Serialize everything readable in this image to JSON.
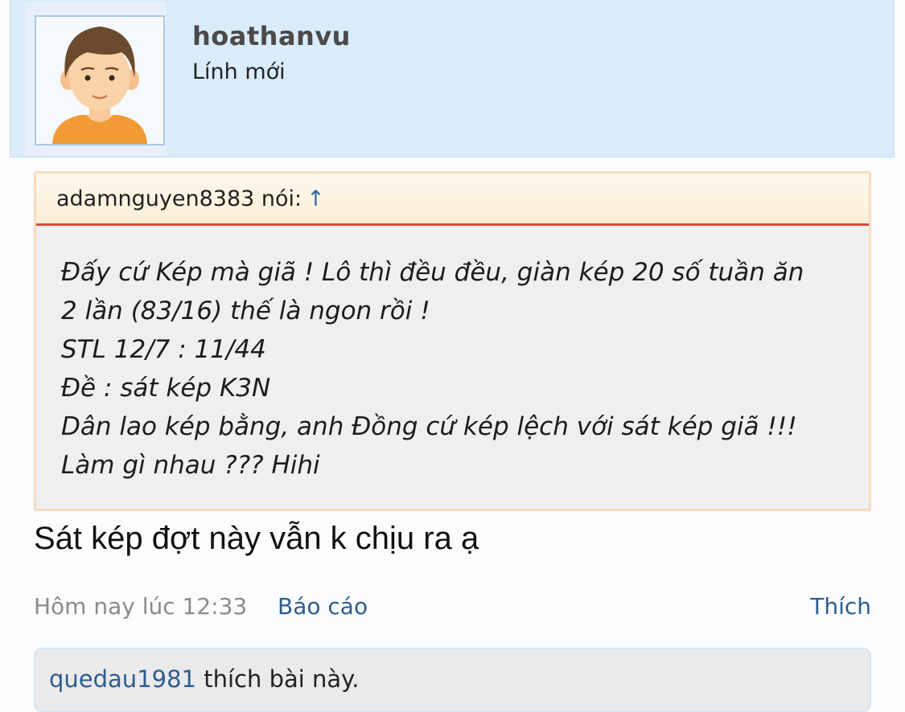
{
  "user": {
    "username": "hoathanvu",
    "title": "Lính mới",
    "avatar": "male-avatar"
  },
  "quote": {
    "author_line": "adamnguyen8383 nói:",
    "arrow": "↑",
    "lines": [
      "Đấy cứ Kép mà giã ! Lô thì đều đều, giàn kép 20 số tuần ăn",
      "2 lần (83/16) thế là ngon rồi !",
      "STL 12/7 : 11/44",
      "Đề : sát kép K3N",
      "Dân lao kép bằng, anh Đồng cứ kép lệch với sát kép giã !!!",
      "Làm gì nhau ??? Hihi"
    ]
  },
  "message": "Sát kép đợt này vẫn k chịu ra ạ",
  "meta": {
    "timestamp": "Hôm nay lúc 12:33",
    "report": "Báo cáo",
    "like": "Thích"
  },
  "likes": {
    "liker": "quedau1981",
    "text": " thích bài này."
  },
  "colors": {
    "link": "#2e5d8f",
    "quote_border": "#f6dcc0",
    "quote_divider": "#d84a3a",
    "user_card_bg": "#daebfa"
  }
}
